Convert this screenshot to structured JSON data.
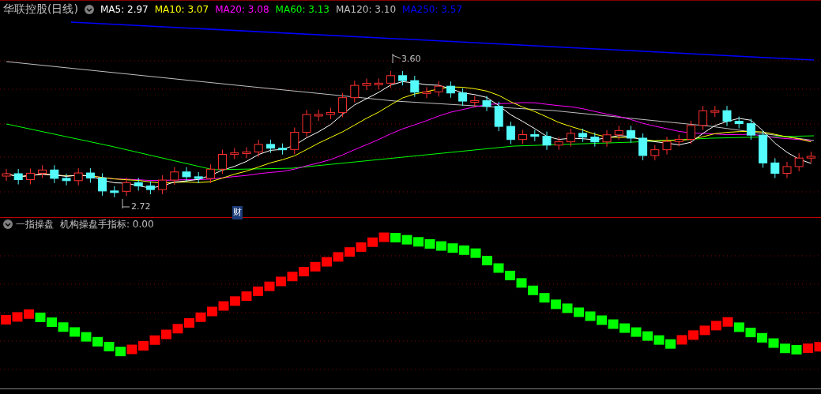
{
  "title": "华联控股(日线)",
  "ma_legend": [
    {
      "label": "MA5: 2.97",
      "color": "#ffffff"
    },
    {
      "label": "MA10: 3.07",
      "color": "#ffff00"
    },
    {
      "label": "MA20: 3.08",
      "color": "#ff00ff"
    },
    {
      "label": "MA60: 3.13",
      "color": "#00ff00"
    },
    {
      "label": "MA120: 3.10",
      "color": "#c0c0c0"
    },
    {
      "label": "MA250: 3.57",
      "color": "#0000ff"
    }
  ],
  "price_chart": {
    "high_label": "3.60",
    "low_label": "2.72",
    "finance_badge": "财"
  },
  "indicator": {
    "name": "一指操盘",
    "reading": "机构操盘手指标: 0.00"
  }
}
